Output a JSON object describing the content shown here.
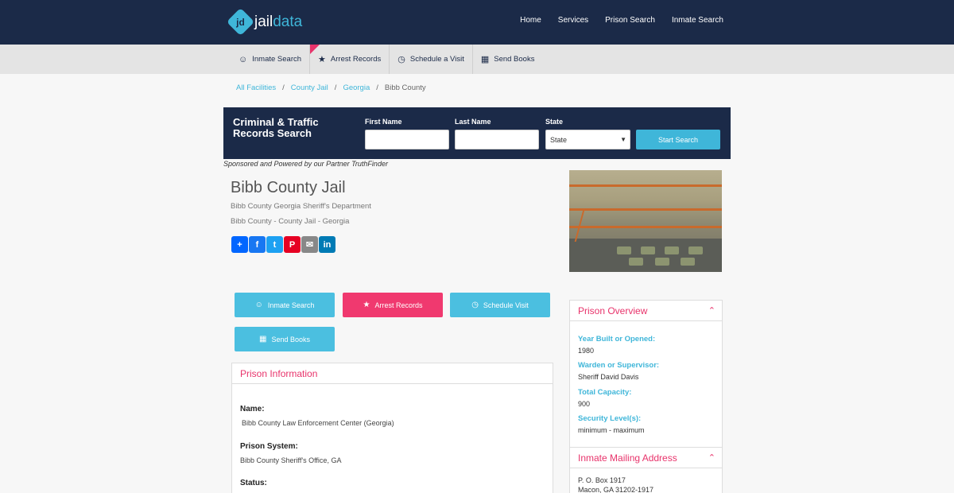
{
  "brand": {
    "name_part1": "jail",
    "name_part2": "data",
    "badge": "jd"
  },
  "topnav": [
    "Home",
    "Services",
    "Prison Search",
    "Inmate Search"
  ],
  "subnav": [
    {
      "label": "Inmate Search",
      "icon": "users-icon"
    },
    {
      "label": "Arrest Records",
      "icon": "star-icon"
    },
    {
      "label": "Schedule a Visit",
      "icon": "clock-icon"
    },
    {
      "label": "Send Books",
      "icon": "book-icon"
    }
  ],
  "breadcrumb": [
    "All Facilities",
    "County Jail",
    "Georgia",
    "Bibb County"
  ],
  "search": {
    "title": "Criminal & Traffic Records Search",
    "first_name_label": "First Name",
    "last_name_label": "Last Name",
    "state_label": "State",
    "state_value": "State",
    "button": "Start Search"
  },
  "sponsor": "Sponsored and Powered by our Partner TruthFinder",
  "facility": {
    "title": "Bibb County Jail",
    "department": "Bibb County Georgia Sheriff's Department",
    "location": "Bibb County - County Jail - Georgia"
  },
  "actions": [
    {
      "label": "Inmate Search",
      "color": "#4bbfe0"
    },
    {
      "label": "Arrest Records",
      "color": "#f0396f"
    },
    {
      "label": "Schedule Visit",
      "color": "#4bbfe0"
    },
    {
      "label": "Send Books",
      "color": "#4bbfe0"
    }
  ],
  "prison_info": {
    "heading": "Prison Information",
    "name_label": "Name:",
    "name_value": "Bibb County Law Enforcement Center (Georgia)",
    "system_label": "Prison System:",
    "system_value": "Bibb County Sheriff's Office, GA",
    "status_label": "Status:"
  },
  "overview": {
    "heading": "Prison Overview",
    "year_label": "Year Built or Opened:",
    "year_value": "1980",
    "warden_label": "Warden or Supervisor:",
    "warden_value": "Sheriff David Davis",
    "capacity_label": "Total Capacity:",
    "capacity_value": "900",
    "security_label": "Security Level(s):",
    "security_value": "minimum - maximum"
  },
  "mailing": {
    "heading": "Inmate Mailing Address",
    "line1": "P. O. Box 1917",
    "line2": "Macon, GA 31202-1917"
  },
  "colors": {
    "navy": "#1b2a48",
    "cyan": "#3fb6d9",
    "pink": "#e8336b"
  }
}
